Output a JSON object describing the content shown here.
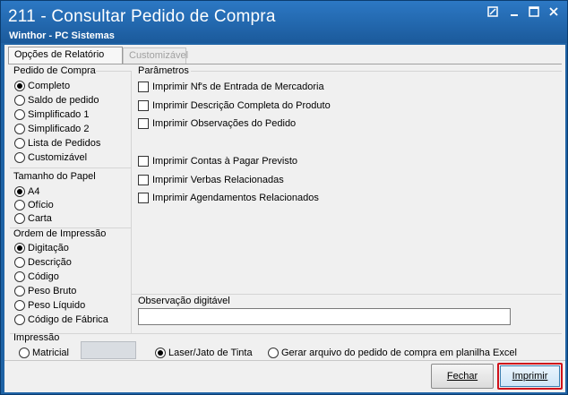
{
  "window": {
    "title": "211 - Consultar Pedido de Compra",
    "subtitle": "Winthor - PC Sistemas"
  },
  "tabs": [
    {
      "label": "Opções de Relatório",
      "active": true
    },
    {
      "label": "Customizável",
      "active": false
    }
  ],
  "pedido_de_compra": {
    "title": "Pedido de Compra",
    "options": [
      "Completo",
      "Saldo de pedido",
      "Simplificado 1",
      "Simplificado 2",
      "Lista de Pedidos",
      "Customizável"
    ],
    "selected": "Completo"
  },
  "tamanho_do_papel": {
    "title": "Tamanho do Papel",
    "options": [
      "A4",
      "Ofício",
      "Carta"
    ],
    "selected": "A4"
  },
  "ordem_de_impressao": {
    "title": "Ordem de Impressão",
    "options": [
      "Digitação",
      "Descrição",
      "Código",
      "Peso Bruto",
      "Peso Líquido",
      "Código de Fábrica"
    ],
    "selected": "Digitação"
  },
  "parametros": {
    "title": "Parâmetros",
    "checks": [
      {
        "label": "Imprimir Nf's de Entrada de Mercadoria",
        "checked": false
      },
      {
        "label": "Imprimir Descrição Completa do Produto",
        "checked": false
      },
      {
        "label": "Imprimir Observações do Pedido",
        "checked": false
      },
      {
        "label": "Imprimir Contas à Pagar Previsto",
        "checked": false
      },
      {
        "label": "Imprimir Verbas Relacionadas",
        "checked": false
      },
      {
        "label": "Imprimir Agendamentos Relacionados",
        "checked": false
      }
    ]
  },
  "observacao": {
    "title": "Observação digitável",
    "value": ""
  },
  "impressao": {
    "title": "Impressão",
    "options": [
      "Matricial",
      "Laser/Jato de Tinta",
      "Gerar arquivo do pedido de compra em planilha Excel"
    ],
    "selected": "Laser/Jato de Tinta"
  },
  "buttons": {
    "fechar": "Fechar",
    "imprimir": "Imprimir"
  }
}
